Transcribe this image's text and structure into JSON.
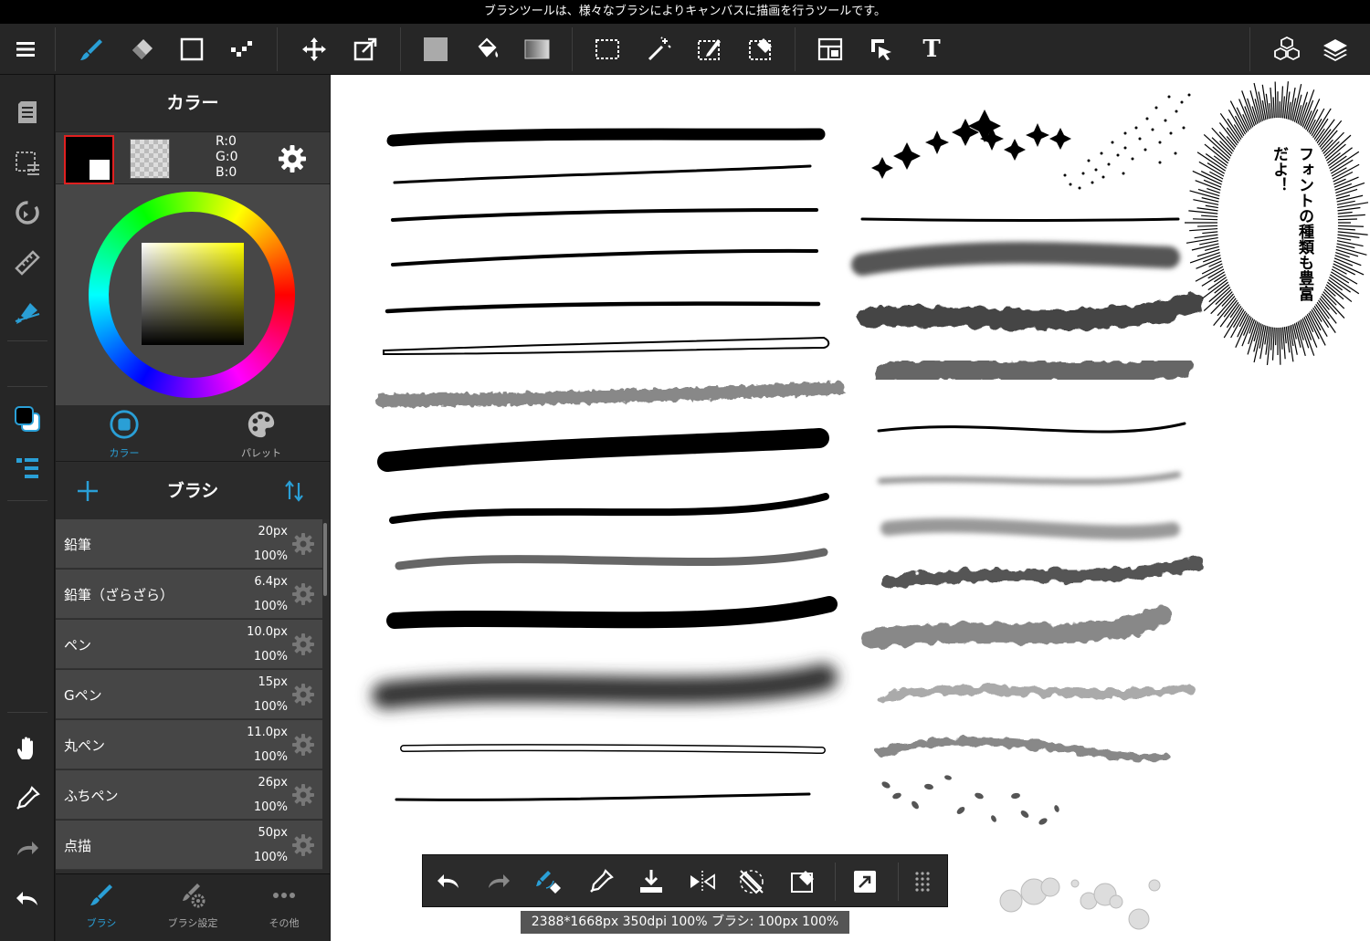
{
  "hint": "ブラシツールは、様々なブラシによりキャンバスに描画を行うツールです。",
  "colors": {
    "accent": "#2a9fd6",
    "active_outline": "#e02020",
    "panel": "#2d2d2d"
  },
  "toolbar": {
    "icons": [
      "menu-icon",
      "brush-tool-icon",
      "eraser-tool-icon",
      "shape-tool-icon",
      "dot-tool-icon",
      "move-tool-icon",
      "transform-tool-icon",
      "fill-color-icon",
      "bucket-tool-icon",
      "gradient-tool-icon",
      "rect-select-icon",
      "magic-wand-icon",
      "select-pen-icon",
      "select-eraser-icon",
      "frame-divider-icon",
      "object-select-icon",
      "text-tool-icon",
      "materials-icon",
      "layers-icon"
    ],
    "text_tool_label": "T"
  },
  "rail": {
    "icons": [
      "page-icon",
      "selection-menu-icon",
      "rotate-icon",
      "ruler-icon",
      "snap-icon",
      "color-toggle-icon",
      "brush-list-icon",
      "hand-icon",
      "eyedropper-icon",
      "redo-icon",
      "undo-icon"
    ]
  },
  "color_panel": {
    "title": "カラー",
    "r": "R:0",
    "g": "G:0",
    "b": "B:0",
    "tabs": [
      {
        "label": "カラー",
        "active": true
      },
      {
        "label": "パレット",
        "active": false
      }
    ]
  },
  "brush_panel": {
    "title": "ブラシ",
    "items": [
      {
        "name": "鉛筆",
        "size": "20px",
        "opacity": "100%"
      },
      {
        "name": "鉛筆（ざらざら）",
        "size": "6.4px",
        "opacity": "100%"
      },
      {
        "name": "ペン",
        "size": "10.0px",
        "opacity": "100%"
      },
      {
        "name": "Gペン",
        "size": "15px",
        "opacity": "100%"
      },
      {
        "name": "丸ペン",
        "size": "11.0px",
        "opacity": "100%"
      },
      {
        "name": "ふちペン",
        "size": "26px",
        "opacity": "100%"
      },
      {
        "name": "点描",
        "size": "50px",
        "opacity": "100%"
      }
    ]
  },
  "bottom_tabs": [
    {
      "label": "ブラシ",
      "active": true
    },
    {
      "label": "ブラシ設定",
      "active": false
    },
    {
      "label": "その他",
      "active": false
    }
  ],
  "canvas": {
    "bubble_text": "フォントの種類も豊富だよ！"
  },
  "quickbar": {
    "icons": [
      "qb-undo-icon",
      "qb-redo-icon",
      "qb-brush-eraser-icon",
      "qb-eyedropper-icon",
      "qb-save-icon",
      "qb-flip-icon",
      "qb-rotate-reset-icon",
      "qb-select-clear-icon",
      "qb-expand-icon",
      "qb-more-icon"
    ]
  },
  "status": "2388*1668px 350dpi 100% ブラシ: 100px 100%"
}
